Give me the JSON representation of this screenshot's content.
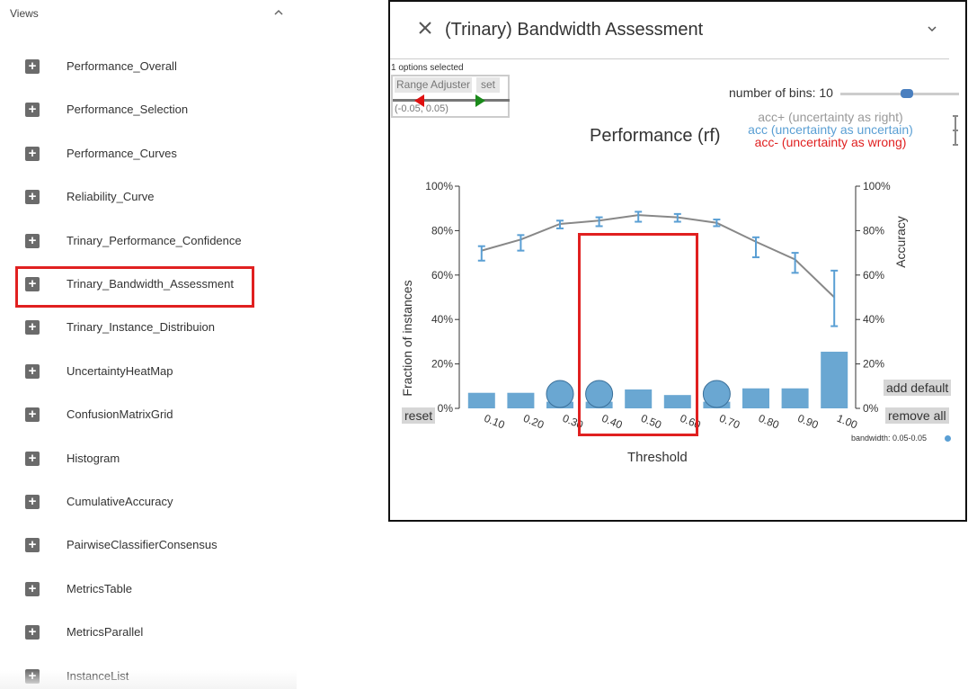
{
  "views": {
    "header": "Views",
    "items": [
      {
        "label": "Performance_Overall"
      },
      {
        "label": "Performance_Selection"
      },
      {
        "label": "Performance_Curves"
      },
      {
        "label": "Reliability_Curve"
      },
      {
        "label": "Trinary_Performance_Confidence"
      },
      {
        "label": "Trinary_Bandwidth_Assessment"
      },
      {
        "label": "Trinary_Instance_Distribuion"
      },
      {
        "label": "UncertaintyHeatMap"
      },
      {
        "label": "ConfusionMatrixGrid"
      },
      {
        "label": "Histogram"
      },
      {
        "label": "CumulativeAccuracy"
      },
      {
        "label": "PairwiseClassifierConsensus"
      },
      {
        "label": "MetricsTable"
      },
      {
        "label": "MetricsParallel"
      },
      {
        "label": "InstanceList"
      }
    ],
    "selected_index": 5
  },
  "panel": {
    "title": "(Trinary) Bandwidth Assessment",
    "options_selected": "1 options selected",
    "range_adjuster": "Range Adjuster",
    "set_label": "set",
    "range_value": "(-0.05, 0.05)",
    "bins_label": "number of bins: 10",
    "reset_label": "reset",
    "add_default_label": "add default",
    "remove_all_label": "remove all",
    "bandwidth_label": "bandwidth: 0.05-0.05"
  },
  "colors": {
    "bar": "#6aa7d2",
    "line": "#888888",
    "error": "#5a9fd4",
    "highlight": "#e02020"
  },
  "chart_data": {
    "type": "bar",
    "title": "Performance (rf)",
    "xlabel": "Threshold",
    "ylabel_left": "Fraction of instances",
    "ylabel_right": "Accuracy",
    "ylim": [
      0,
      100
    ],
    "y_ticks": [
      "0%",
      "20%",
      "40%",
      "60%",
      "80%",
      "100%"
    ],
    "legend": [
      "acc+ (uncertainty as right)",
      "acc (uncertainty as uncertain)",
      "acc- (uncertainty as wrong)"
    ],
    "categories": [
      "0.10",
      "0.20",
      "0.30",
      "0.40",
      "0.50",
      "0.60",
      "0.70",
      "0.80",
      "0.90",
      "1.00"
    ],
    "series": [
      {
        "name": "Fraction of instances",
        "type": "bar",
        "values": [
          7,
          7,
          3,
          3,
          8.5,
          6,
          3,
          9,
          9,
          25.5
        ],
        "bubble": [
          false,
          false,
          true,
          true,
          false,
          false,
          true,
          false,
          false,
          false
        ]
      },
      {
        "name": "acc",
        "type": "line",
        "values": [
          71,
          76,
          83,
          84.5,
          87,
          86,
          83.5,
          75,
          67,
          50
        ],
        "upper": [
          73,
          78,
          84.5,
          86,
          88.5,
          87.5,
          85,
          77,
          70,
          62
        ],
        "lower": [
          66.5,
          71,
          81,
          82,
          84,
          84,
          82,
          68,
          61,
          37
        ]
      }
    ],
    "highlight_categories": [
      "0.40",
      "0.50",
      "0.60"
    ]
  }
}
